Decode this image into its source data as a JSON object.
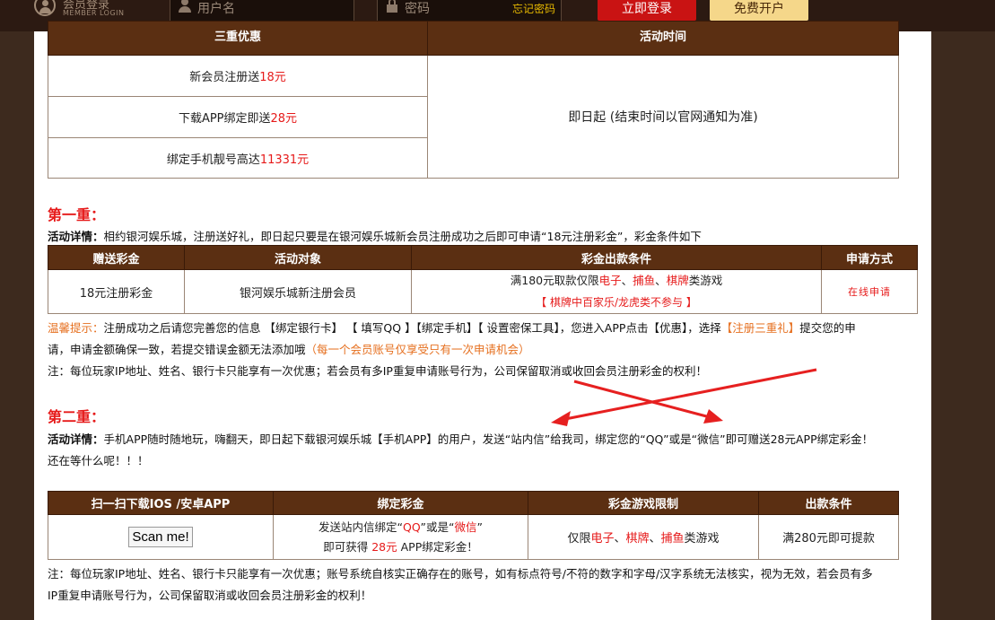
{
  "header": {
    "member_title": "会员登录",
    "member_sub": "MEMBER LOGIN",
    "username_placeholder": "用户名",
    "password_placeholder": "密码",
    "forgot_label": "忘记密码",
    "login_label": "立即登录",
    "open_label": "免费开户"
  },
  "table1": {
    "headers": [
      "三重优惠",
      "活动时间"
    ],
    "rows": [
      {
        "text": "新会员注册送",
        "highlight": "18元"
      },
      {
        "text": "下载APP绑定即送",
        "highlight": "28元"
      },
      {
        "text": "绑定手机靓号高达",
        "highlight": "11331元"
      }
    ],
    "time_text": "即日起 (结束时间以官网通知为准)"
  },
  "section1": {
    "title": "第一重：",
    "detail_label": "活动详情：",
    "detail_text": "相约银河娱乐城，注册送好礼，即日起只要是在银河娱乐城新会员注册成功之后即可申请“18元注册彩金”，彩金条件如下",
    "headers": [
      "赠送彩金",
      "活动对象",
      "彩金出款条件",
      "申请方式"
    ],
    "row": {
      "bonus": "18元注册彩金",
      "target": "银河娱乐城新注册会员",
      "cond_prefix": "满180元取款仅限",
      "game1": "电子",
      "sep1": "、",
      "game2": "捕鱼",
      "sep2": "、",
      "game3": "棋牌",
      "cond_suffix": "类游戏",
      "cond_note": "【 棋牌中百家乐/龙虎类不参与 】",
      "apply": "在线申请"
    },
    "hint_label": "温馨提示：",
    "hint_text": "注册成功之后请您完善您的信息 【绑定银行卡】 【 填写QQ 】【绑定手机】【 设置密保工具】，您进入APP点击【优惠】，选择",
    "hint_red": "【注册三重礼】",
    "hint_text2": "提交您的申",
    "hint_line2": "请，申请金额确保一致，若提交错误金额无法添加哦",
    "hint_line2_red": "（每一个会员账号仅享受只有一次申请机会）",
    "note": "注：每位玩家IP地址、姓名、银行卡只能享有一次优惠；若会员有多IP重复申请账号行为，公司保留取消或收回会员注册彩金的权利！"
  },
  "section2": {
    "title": "第二重：",
    "detail_label": "活动详情：",
    "detail_text": "手机APP随时随地玩，嗨翻天，即日起下载银河娱乐城【手机APP】的用户，发送“站内信”给我司，绑定您的“QQ”或是“微信”即可赠送28元APP绑定彩金！",
    "detail_line2": "还在等什么呢！！！",
    "headers": [
      "扫一扫下载IOS /安卓APP",
      "绑定彩金",
      "彩金游戏限制",
      "出款条件"
    ],
    "row": {
      "scan": "Scan me!",
      "bind_prefix": "发送站内信绑定“",
      "qq": "QQ",
      "bind_mid": "”或是“",
      "wechat": "微信",
      "bind_end": "”",
      "bind2_prefix": "即可获得 ",
      "bind2_amount": "28元",
      "bind2_suffix": " APP绑定彩金！",
      "limit_prefix": "仅限",
      "g1": "电子",
      "s1": "、",
      "g2": "棋牌",
      "s2": "、",
      "g3": "捕鱼",
      "limit_suffix": "类游戏",
      "withdraw": "满280元即可提款"
    },
    "note1": "注：每位玩家IP地址、姓名、银行卡只能享有一次优惠；账号系统自核实正确存在的账号，如有标点符号/不符的数字和字母/汉字系统无法核实，视为无效，若会员有多",
    "note2": "IP重复申请账号行为，公司保留取消或收回会员注册彩金的权利！"
  },
  "colors": {
    "header_bg": "#5b2f12",
    "accent_red": "#e61a1a",
    "login_btn": "#c91313",
    "open_btn": "#f5d78a",
    "hint_orange": "#e67020"
  }
}
